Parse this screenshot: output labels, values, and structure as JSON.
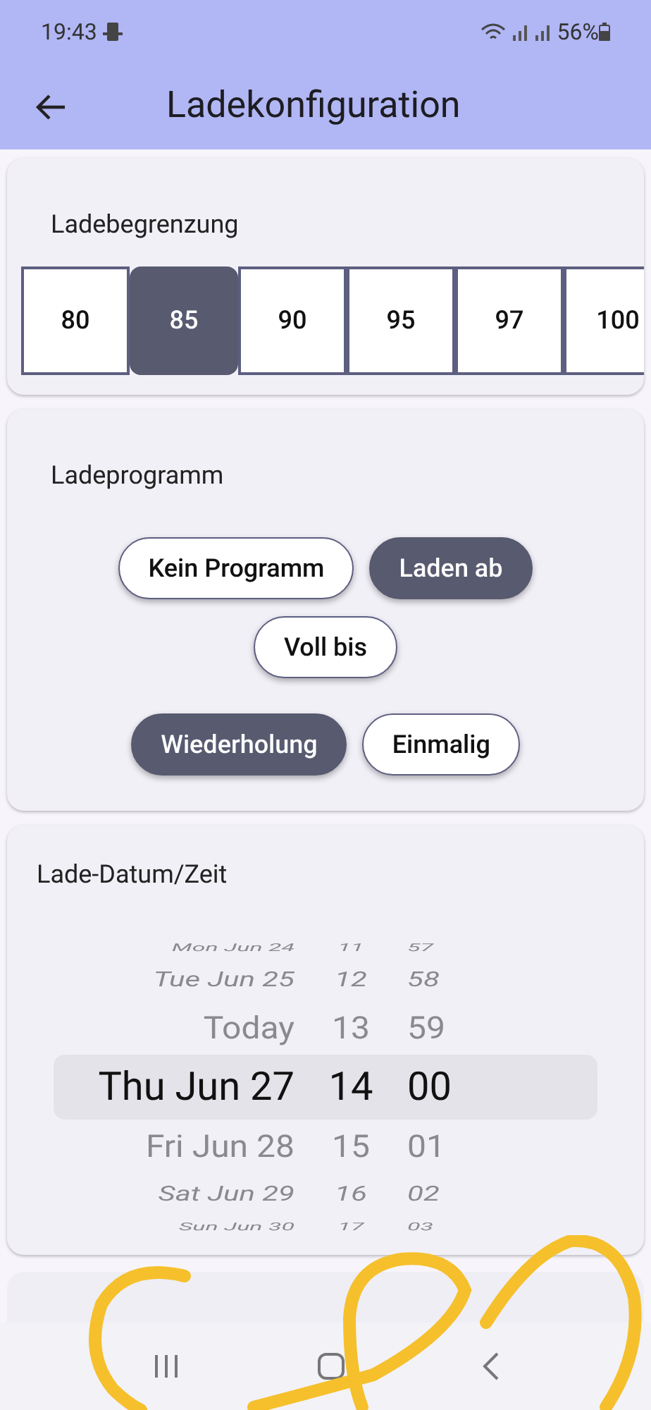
{
  "status_bar": {
    "time": "19:43",
    "battery": "56%"
  },
  "app_bar": {
    "title": "Ladekonfiguration"
  },
  "charge_limit": {
    "title": "Ladebegrenzung",
    "options": [
      {
        "label": "80",
        "selected": false
      },
      {
        "label": "85",
        "selected": true
      },
      {
        "label": "90",
        "selected": false
      },
      {
        "label": "95",
        "selected": false
      },
      {
        "label": "97",
        "selected": false
      },
      {
        "label": "100",
        "selected": false
      }
    ]
  },
  "charge_program": {
    "title": "Ladeprogramm",
    "rows": [
      [
        {
          "label": "Kein Programm",
          "selected": false
        },
        {
          "label": "Laden ab",
          "selected": true
        }
      ],
      [
        {
          "label": "Voll bis",
          "selected": false
        }
      ],
      [
        {
          "label": "Wiederholung",
          "selected": true
        },
        {
          "label": "Einmalig",
          "selected": false
        }
      ]
    ]
  },
  "date_time": {
    "title": "Lade-Datum/Zeit",
    "rows": [
      {
        "date": "Mon Jun 24",
        "hour": "11",
        "minute": "57",
        "selected": false
      },
      {
        "date": "Tue Jun 25",
        "hour": "12",
        "minute": "58",
        "selected": false
      },
      {
        "date": "Today",
        "hour": "13",
        "minute": "59",
        "selected": false
      },
      {
        "date": "Thu Jun 27",
        "hour": "14",
        "minute": "00",
        "selected": true
      },
      {
        "date": "Fri Jun 28",
        "hour": "15",
        "minute": "01",
        "selected": false
      },
      {
        "date": "Sat Jun 29",
        "hour": "16",
        "minute": "02",
        "selected": false
      },
      {
        "date": "Sun Jun 30",
        "hour": "17",
        "minute": "03",
        "selected": false
      }
    ]
  }
}
